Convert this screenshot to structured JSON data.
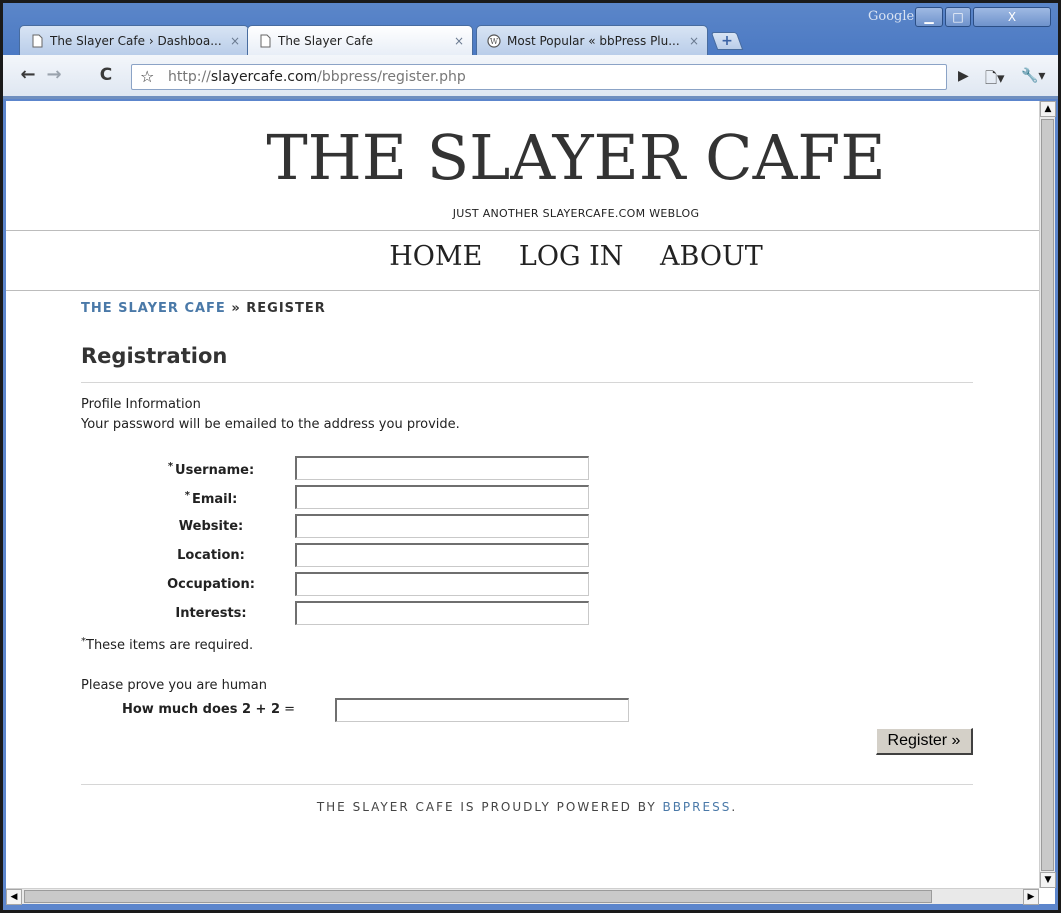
{
  "browser": {
    "tabs": [
      {
        "title": "The Slayer Cafe › Dashboa...",
        "close": "×",
        "active": false
      },
      {
        "title": "The Slayer Cafe",
        "close": "×",
        "active": true
      },
      {
        "title": "Most Popular « bbPress Plu...",
        "close": "×",
        "active": false
      }
    ],
    "new_tab_icon": "+",
    "google_label": "Google",
    "window_buttons": {
      "minimize": "▁",
      "maximize": "□",
      "close": "X"
    },
    "url": {
      "scheme": "http://",
      "host": "slayercafe.com",
      "path": "/bbpress/register.php"
    },
    "icons": [
      "back-icon",
      "forward-icon",
      "reload-icon",
      "star-icon",
      "play-icon",
      "page-menu-icon",
      "wrench-icon"
    ]
  },
  "site": {
    "title": "THE SLAYER CAFE",
    "tagline": "JUST ANOTHER SLAYERCAFE.COM WEBLOG",
    "nav": [
      "HOME",
      "LOG IN",
      "ABOUT"
    ]
  },
  "breadcrumb": {
    "link": "THE SLAYER CAFE",
    "separator": " » ",
    "current": "REGISTER"
  },
  "form": {
    "heading": "Registration",
    "section": "Profile Information",
    "note": "Your password will be emailed to the address you provide.",
    "fields": [
      {
        "label": "Username:",
        "required": true,
        "value": ""
      },
      {
        "label": "Email:",
        "required": true,
        "value": ""
      },
      {
        "label": "Website:",
        "required": false,
        "value": ""
      },
      {
        "label": "Location:",
        "required": false,
        "value": ""
      },
      {
        "label": "Occupation:",
        "required": false,
        "value": ""
      },
      {
        "label": "Interests:",
        "required": false,
        "value": ""
      }
    ],
    "required_marker": "*",
    "required_note": "These items are required.",
    "captcha_intro": "Please prove you are human",
    "captcha_question": "How much does 2 + 2",
    "captcha_eq": " =",
    "captcha_value": "",
    "submit_label": "Register »"
  },
  "footer": {
    "text": "THE SLAYER CAFE IS PROUDLY POWERED BY ",
    "link": "BBPRESS",
    "end": "."
  }
}
